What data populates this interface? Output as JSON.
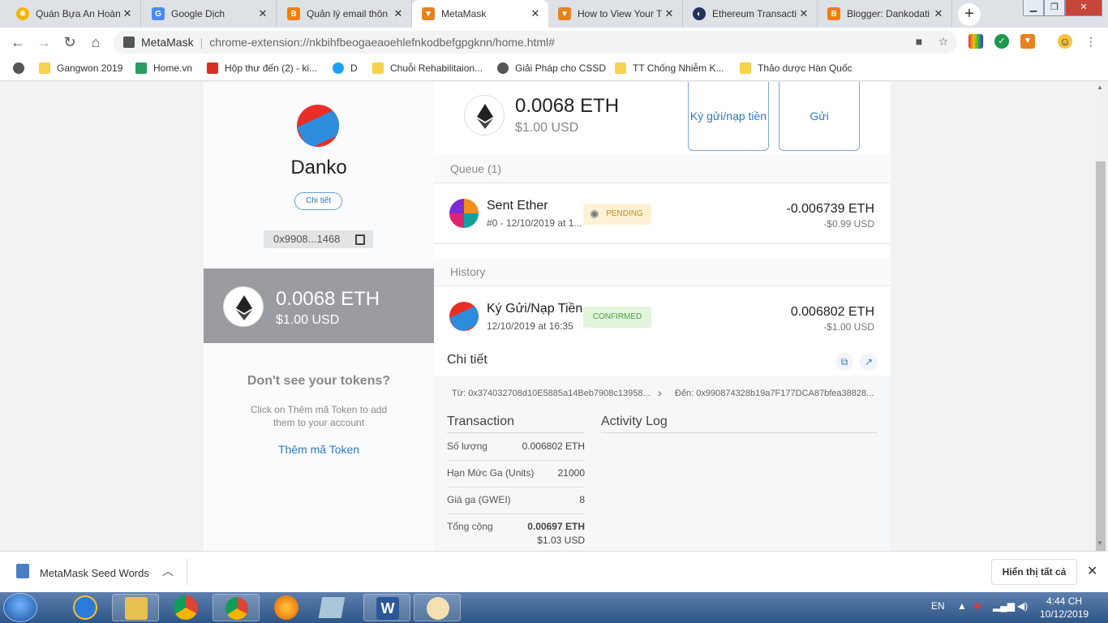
{
  "browser": {
    "tabs": [
      {
        "title": "Quán Bựa An Hoàn",
        "active": false
      },
      {
        "title": "Google Dịch",
        "active": false
      },
      {
        "title": "Quản lý email thôn",
        "active": false
      },
      {
        "title": "MetaMask",
        "active": true
      },
      {
        "title": "How to View Your T",
        "active": false
      },
      {
        "title": "Ethereum Transacti",
        "active": false
      },
      {
        "title": "Blogger: Dankodati",
        "active": false
      }
    ],
    "new_tab": "+",
    "omnibox": {
      "site": "MetaMask",
      "url": "chrome-extension://nkbihfbeogaeaoehlefnkodbefgpgknn/home.html#"
    },
    "bookmarks": [
      {
        "label": "Gangwon 2019"
      },
      {
        "label": "Home.vn"
      },
      {
        "label": "Hộp thư đến (2) - ki..."
      },
      {
        "label": "D"
      },
      {
        "label": "Chuỗi Rehabilitaion..."
      },
      {
        "label": "Giải Pháp cho CSSD"
      },
      {
        "label": "TT Chống Nhiễm K..."
      },
      {
        "label": "Thảo dược Hàn Quốc"
      }
    ]
  },
  "sidebar": {
    "account_name": "Danko",
    "details_button": "Chi tiết",
    "address": "0x9908...1468",
    "balance_eth": "0.0068 ETH",
    "balance_usd": "$1.00 USD",
    "no_tokens_heading": "Don't see your tokens?",
    "no_tokens_text": "Click on Thêm mã Token to add them to your account",
    "add_token": "Thêm mã Token"
  },
  "main": {
    "balance_eth": "0.0068 ETH",
    "balance_usd": "$1.00 USD",
    "deposit_button": "Ký gửi/nạp tiền",
    "send_button": "Gửi",
    "queue_header": "Queue (1)",
    "history_header": "History",
    "queue": [
      {
        "title": "Sent Ether",
        "sub": "#0 - 12/10/2019 at 1...",
        "status": "PENDING",
        "amount": "-0.006739 ETH",
        "amount_usd": "-$0.99 USD"
      }
    ],
    "history": [
      {
        "title": "Ký Gửi/Nạp Tiền",
        "sub": "12/10/2019 at 16:35",
        "status": "CONFIRMED",
        "amount": "0.006802 ETH",
        "amount_usd": "-$1.00 USD"
      }
    ],
    "details": {
      "title": "Chi tiết",
      "from": "Từ: 0x374032708d10E5885a14Beb7908c13958...",
      "to": "Đến: 0x990874328b19a7F177DCA87bfea38828...",
      "transaction_header": "Transaction",
      "activity_header": "Activity Log",
      "rows": [
        {
          "label": "Số lượng",
          "value": "0.006802 ETH"
        },
        {
          "label": "Hạn Mức Ga (Units)",
          "value": "21000"
        },
        {
          "label": "Giá ga (GWEI)",
          "value": "8"
        },
        {
          "label": "Tổng cộng",
          "value": "0.00697 ETH",
          "value2": "$1.03 USD"
        }
      ]
    }
  },
  "download_bar": {
    "file": "MetaMask Seed Words",
    "show_all": "Hiển thị tất cả"
  },
  "taskbar": {
    "lang": "EN",
    "time": "4:44 CH",
    "date": "10/12/2019"
  },
  "colors": {
    "accent": "#2f79c2",
    "pending": "#d08a0f",
    "confirmed": "#4da140",
    "balance_panel": "#9b9ba2"
  }
}
